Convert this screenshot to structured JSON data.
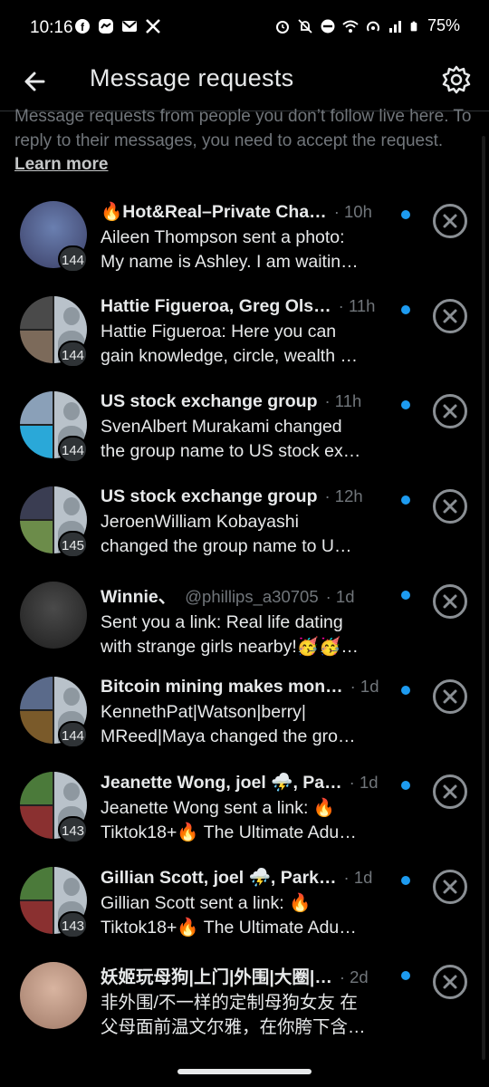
{
  "status_bar": {
    "time": "10:16",
    "battery": "75%",
    "left_icons": [
      "facebook-icon",
      "messenger-icon",
      "gmail-icon",
      "x-icon"
    ],
    "right_icons": [
      "alarm-icon",
      "mute-icon",
      "dnd-icon",
      "wifi-icon",
      "hotspot-icon",
      "signal-icon",
      "battery-icon"
    ]
  },
  "header": {
    "title": "Message requests",
    "back_icon": "arrow-left-icon",
    "settings_icon": "gear-icon"
  },
  "intro": {
    "text": "Message requests from people you don’t follow live here. To reply to their messages, you need to accept the request.",
    "link": "Learn more"
  },
  "requests": [
    {
      "name": "🔥Hot&Real–Private Cha…",
      "handle": "",
      "time": "· 10h",
      "line1": "Aileen Thompson sent a photo:",
      "line2": "My name is Ashley. I am waitin…",
      "count": "144",
      "avatar": "single",
      "colors": [
        "#6a7fb0",
        "#3b3f66"
      ]
    },
    {
      "name": "Hattie Figueroa, Greg Ols…",
      "handle": "",
      "time": "· 11h",
      "line1": "Hattie Figueroa: Here you can",
      "line2": "gain knowledge, circle, wealth …",
      "count": "144",
      "avatar": "split",
      "colors": [
        "#4a4a4a",
        "#7c6a5a"
      ]
    },
    {
      "name": "US stock exchange group",
      "handle": "",
      "time": "· 11h",
      "line1": "SvenAlbert Murakami changed",
      "line2": "the group name to US stock ex…",
      "count": "144",
      "avatar": "split",
      "colors": [
        "#8aa0b8",
        "#2aa8d8"
      ]
    },
    {
      "name": "US stock exchange group",
      "handle": "",
      "time": "· 12h",
      "line1": "JeroenWilliam Kobayashi",
      "line2": "changed the group name to U…",
      "count": "145",
      "avatar": "split",
      "colors": [
        "#3a3d52",
        "#6c8c4a"
      ]
    },
    {
      "name": "Winnie、",
      "handle": "@phillips_a30705",
      "time": "· 1d",
      "line1": "Sent you a link: Real life dating",
      "line2": "with strange girls nearby!🥳🥳…",
      "count": "",
      "avatar": "single",
      "colors": [
        "#4a4a4a",
        "#1e1e1e"
      ]
    },
    {
      "name": "Bitcoin mining makes mon…",
      "handle": "",
      "time": "· 1d",
      "line1": "KennethPat|Watson|berry|",
      "line2": "MReed|Maya changed the gro…",
      "count": "144",
      "avatar": "split",
      "colors": [
        "#5a6a8a",
        "#7a5a2a"
      ]
    },
    {
      "name": "Jeanette Wong, joel ⛈️, Pa…",
      "handle": "",
      "time": "· 1d",
      "line1": "Jeanette Wong sent a link: 🔥",
      "line2": "Tiktok18+🔥 The Ultimate Adu…",
      "count": "143",
      "avatar": "split",
      "colors": [
        "#4b7a3a",
        "#8a3030"
      ]
    },
    {
      "name": "Gillian Scott, joel ⛈️, Park…",
      "handle": "",
      "time": "· 1d",
      "line1": "Gillian Scott sent a link: 🔥",
      "line2": "Tiktok18+🔥 The Ultimate Adu…",
      "count": "143",
      "avatar": "split",
      "colors": [
        "#4b7a3a",
        "#8a3030"
      ]
    },
    {
      "name": "妖姬玩母狗|上门|外围|大圈|…",
      "handle": "",
      "time": "· 2d",
      "line1": "非外围/不一样的定制母狗女友 在",
      "line2": "父母面前温文尔雅，在你胯下含…",
      "count": "",
      "avatar": "single",
      "colors": [
        "#d8b4a0",
        "#a07a68"
      ]
    }
  ]
}
